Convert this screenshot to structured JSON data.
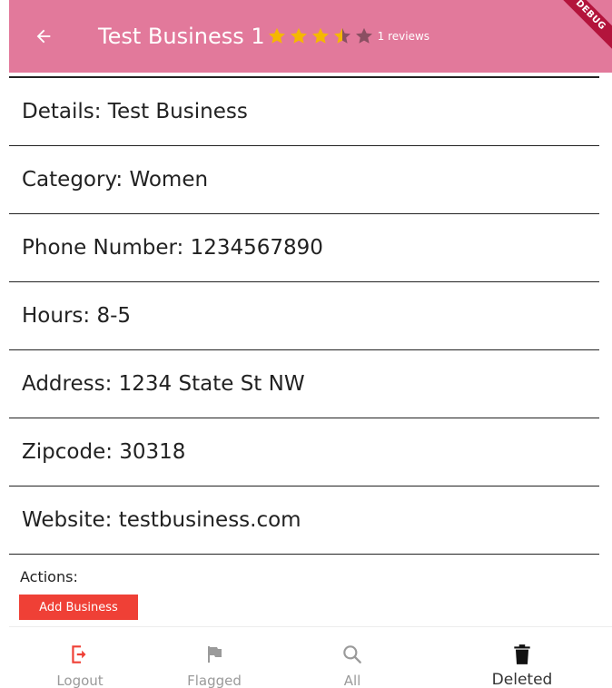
{
  "appbar": {
    "title": "Test Business 1",
    "rating": 3.5,
    "max_rating": 5,
    "reviews": "1 reviews",
    "debug_banner": "DEBUG",
    "back_icon": "arrow-left-icon"
  },
  "details": [
    {
      "text": "Details: Test Business"
    },
    {
      "text": "Category: Women"
    },
    {
      "text": "Phone Number: 1234567890"
    },
    {
      "text": "Hours: 8-5"
    },
    {
      "text": "Address: 1234 State St NW"
    },
    {
      "text": "Zipcode: 30318"
    },
    {
      "text": "Website: testbusiness.com"
    }
  ],
  "actions": {
    "label": "Actions:",
    "add_business": "Add Business"
  },
  "nav": {
    "items": [
      {
        "label": "Logout",
        "icon": "logout-icon"
      },
      {
        "label": "Flagged",
        "icon": "flag-icon"
      },
      {
        "label": "All",
        "icon": "search-icon"
      },
      {
        "label": "Deleted",
        "icon": "trash-icon"
      }
    ],
    "active": "Deleted"
  },
  "colors": {
    "appbar": "#e2799b",
    "star_filled": "#f5b800",
    "star_empty": "#8a4f62",
    "accent_red": "#ef4036",
    "debug": "#b3143c"
  }
}
